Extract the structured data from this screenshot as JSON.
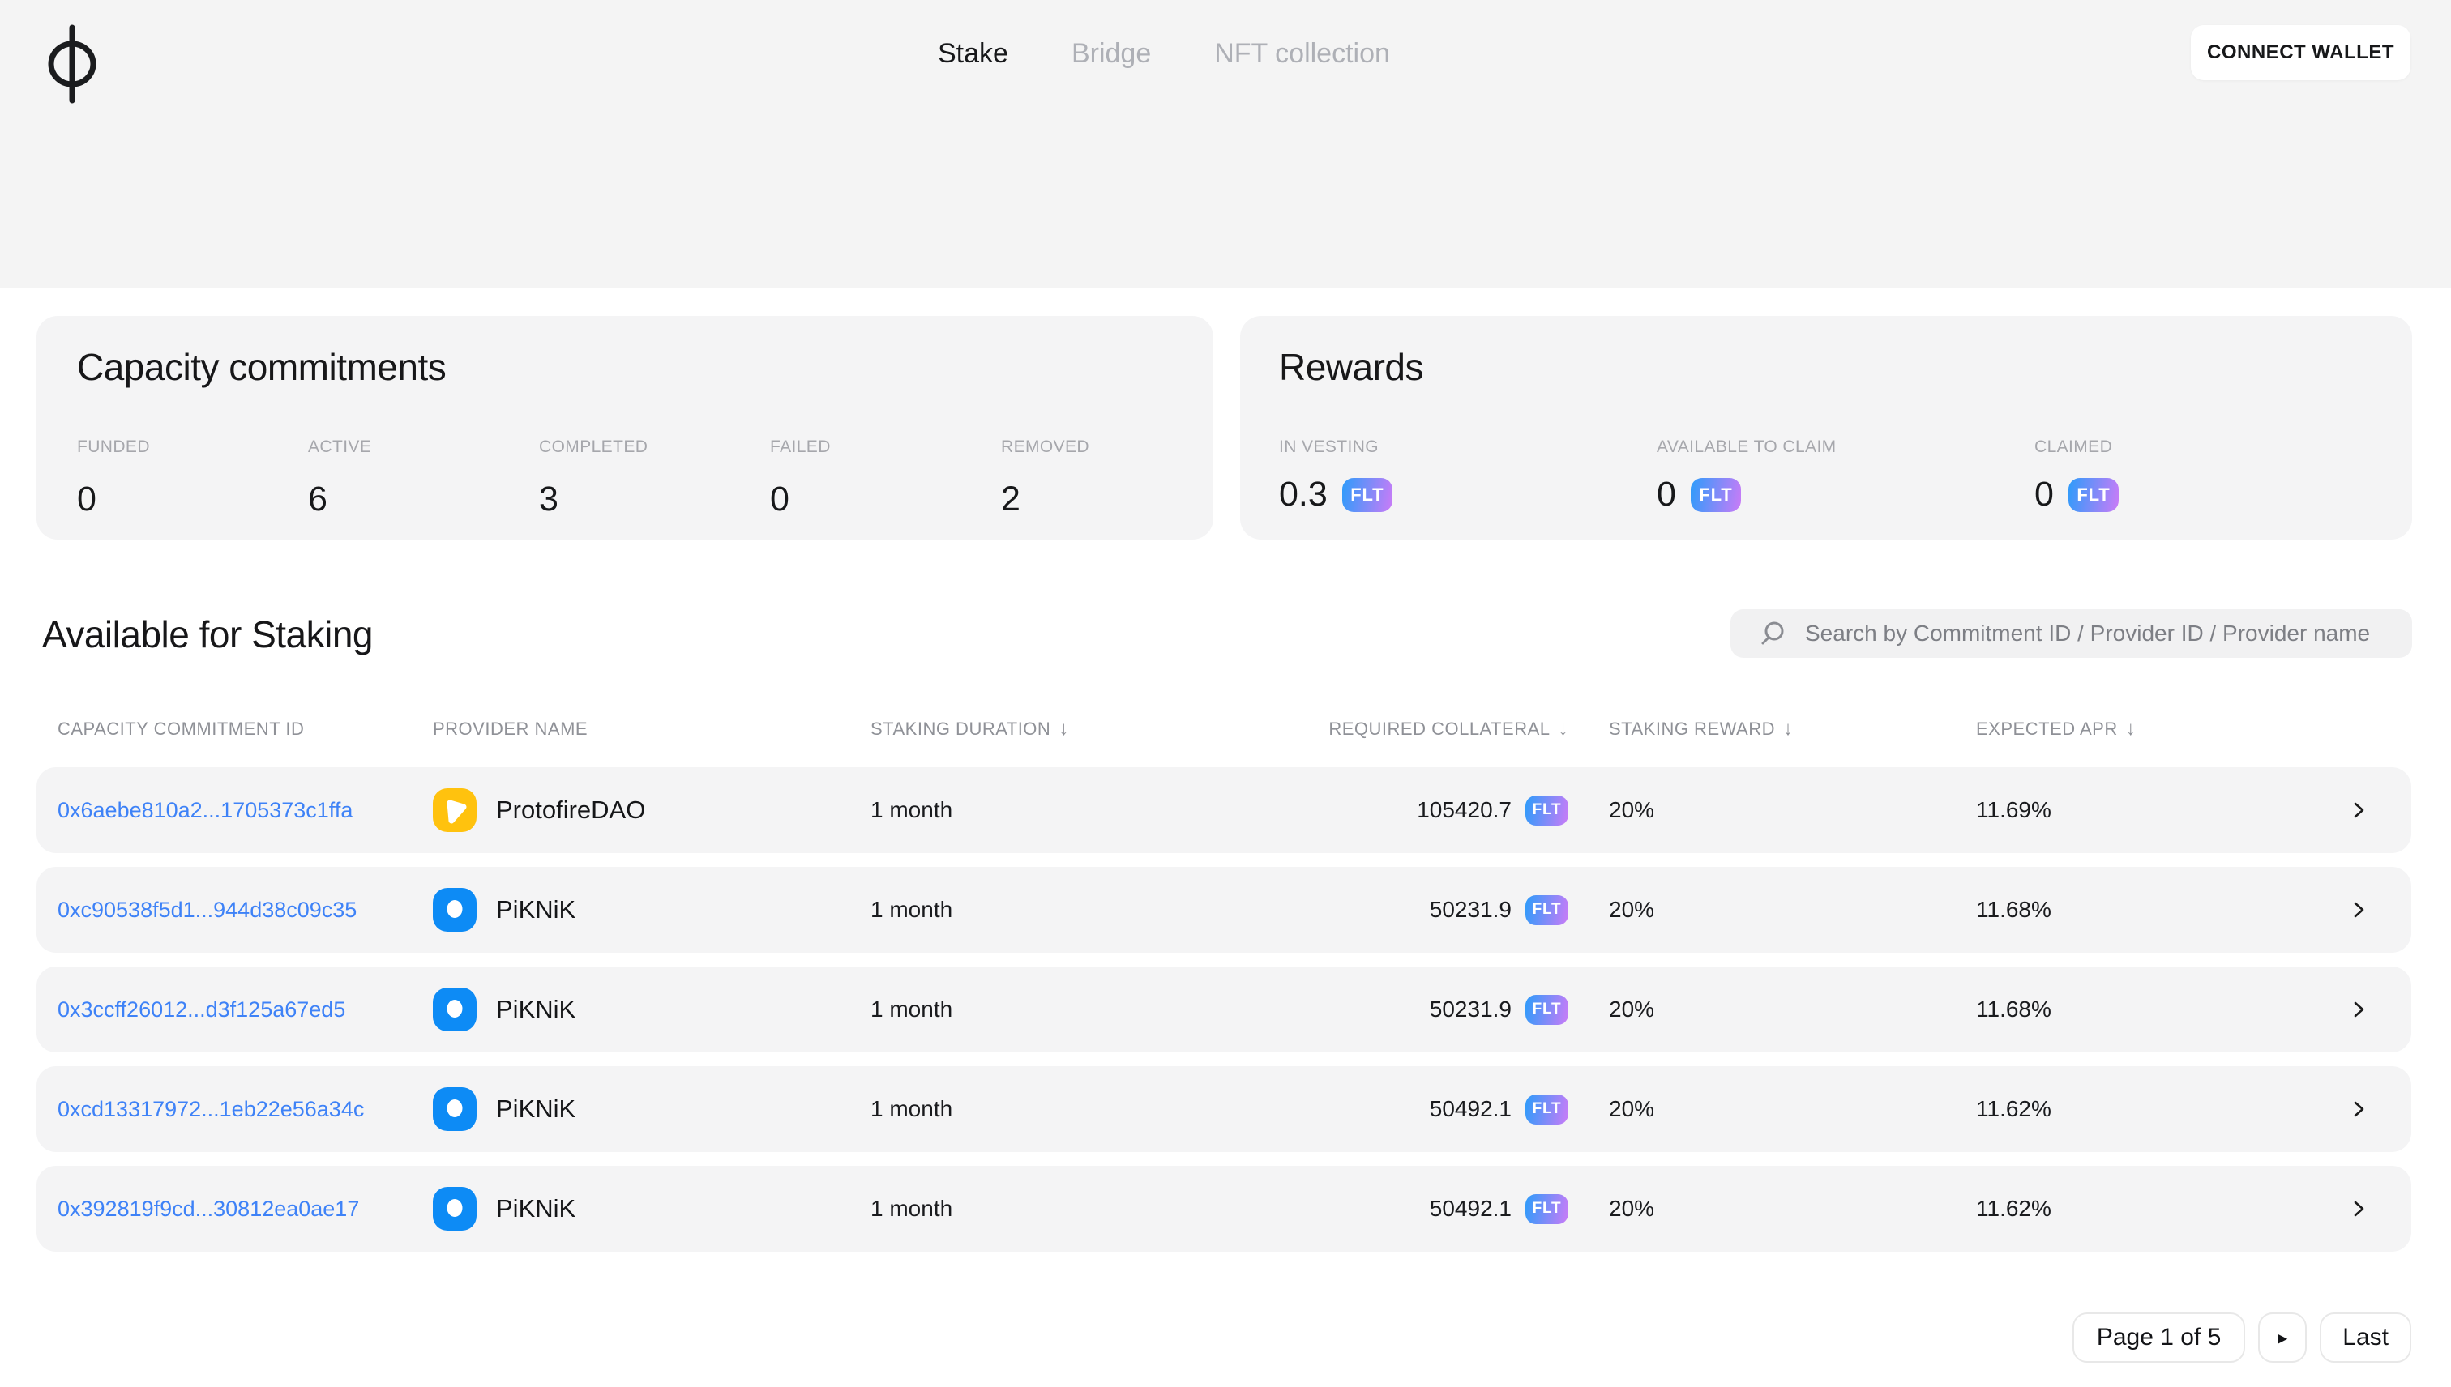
{
  "colors": {
    "header_bg": "#F4F4F4",
    "card_bg": "#F4F4F5",
    "link_blue": "#3E82F7",
    "badge_gradient_start": "#2D9CFA",
    "badge_gradient_end": "#CB7BF7",
    "piknik_avatar_bg": "#0D8BF5",
    "protofire_avatar_bg": "#FFC20E"
  },
  "nav": {
    "tabs": [
      {
        "label": "Stake",
        "active": true
      },
      {
        "label": "Bridge",
        "active": false
      },
      {
        "label": "NFT collection",
        "active": false
      }
    ],
    "connect_wallet_label": "CONNECT WALLET"
  },
  "capacity_commitments": {
    "title": "Capacity commitments",
    "stats": [
      {
        "label": "FUNDED",
        "value": "0"
      },
      {
        "label": "ACTIVE",
        "value": "6"
      },
      {
        "label": "COMPLETED",
        "value": "3"
      },
      {
        "label": "FAILED",
        "value": "0"
      },
      {
        "label": "REMOVED",
        "value": "2"
      }
    ]
  },
  "rewards": {
    "title": "Rewards",
    "stats": [
      {
        "label": "IN VESTING",
        "value": "0.3",
        "token": "FLT"
      },
      {
        "label": "AVAILABLE TO CLAIM",
        "value": "0",
        "token": "FLT"
      },
      {
        "label": "CLAIMED",
        "value": "0",
        "token": "FLT"
      }
    ]
  },
  "staking": {
    "title": "Available for Staking",
    "search_placeholder": "Search by Commitment ID / Provider ID / Provider name",
    "sort_icon": "↓",
    "columns": [
      {
        "label": "CAPACITY COMMITMENT ID",
        "sortable": false
      },
      {
        "label": "PROVIDER NAME",
        "sortable": false
      },
      {
        "label": "STAKING DURATION",
        "sortable": true
      },
      {
        "label": "REQUIRED COLLATERAL",
        "sortable": true
      },
      {
        "label": "STAKING REWARD",
        "sortable": true
      },
      {
        "label": "EXPECTED APR",
        "sortable": true
      }
    ],
    "rows": [
      {
        "id": "0x6aebe810a2...1705373c1ffa",
        "provider": "ProtofireDAO",
        "avatar_glyph": "triangle",
        "avatar_bg": "#FFC20E",
        "duration": "1 month",
        "collateral": "105420.7",
        "token": "FLT",
        "reward": "20%",
        "apr": "11.69%"
      },
      {
        "id": "0xc90538f5d1...944d38c09c35",
        "provider": "PiKNiK",
        "avatar_glyph": "circle",
        "avatar_bg": "#0D8BF5",
        "duration": "1 month",
        "collateral": "50231.9",
        "token": "FLT",
        "reward": "20%",
        "apr": "11.68%"
      },
      {
        "id": "0x3ccff26012...d3f125a67ed5",
        "provider": "PiKNiK",
        "avatar_glyph": "circle",
        "avatar_bg": "#0D8BF5",
        "duration": "1 month",
        "collateral": "50231.9",
        "token": "FLT",
        "reward": "20%",
        "apr": "11.68%"
      },
      {
        "id": "0xcd13317972...1eb22e56a34c",
        "provider": "PiKNiK",
        "avatar_glyph": "circle",
        "avatar_bg": "#0D8BF5",
        "duration": "1 month",
        "collateral": "50492.1",
        "token": "FLT",
        "reward": "20%",
        "apr": "11.62%"
      },
      {
        "id": "0x392819f9cd...30812ea0ae17",
        "provider": "PiKNiK",
        "avatar_glyph": "circle",
        "avatar_bg": "#0D8BF5",
        "duration": "1 month",
        "collateral": "50492.1",
        "token": "FLT",
        "reward": "20%",
        "apr": "11.62%"
      }
    ]
  },
  "pagination": {
    "page_label": "Page 1 of 5",
    "next_icon": "▸",
    "last_label": "Last"
  }
}
